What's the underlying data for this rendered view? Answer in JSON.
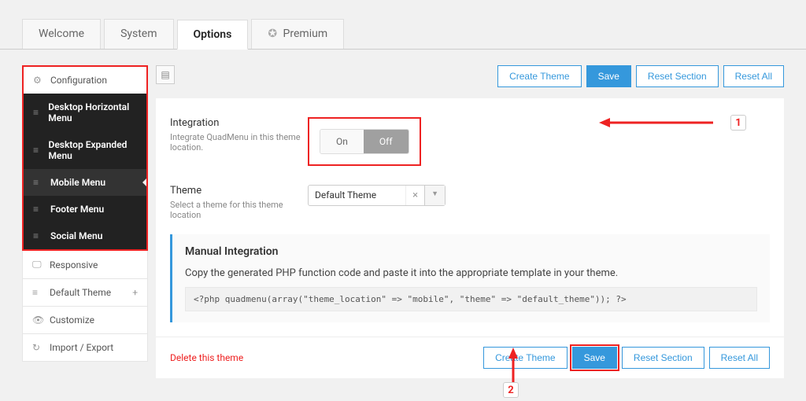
{
  "tabs": {
    "welcome": "Welcome",
    "system": "System",
    "options": "Options",
    "premium": "Premium"
  },
  "sidebar": {
    "configuration": "Configuration",
    "desktop_horizontal": "Desktop Horizontal Menu",
    "desktop_expanded": "Desktop Expanded Menu",
    "mobile_menu": "Mobile Menu",
    "footer_menu": "Footer Menu",
    "social_menu": "Social Menu",
    "responsive": "Responsive",
    "default_theme": "Default Theme",
    "customize": "Customize",
    "import_export": "Import / Export"
  },
  "toolbar": {
    "create_theme": "Create Theme",
    "save": "Save",
    "reset_section": "Reset Section",
    "reset_all": "Reset All"
  },
  "integration": {
    "title": "Integration",
    "desc": "Integrate QuadMenu in this theme location.",
    "on": "On",
    "off": "Off"
  },
  "theme_row": {
    "title": "Theme",
    "desc": "Select a theme for this theme location",
    "value": "Default Theme"
  },
  "manual": {
    "title": "Manual Integration",
    "text": "Copy the generated PHP function code and paste it into the appropriate template in your theme.",
    "code": "<?php quadmenu(array(\"theme_location\" => \"mobile\", \"theme\" => \"default_theme\")); ?>"
  },
  "footer": {
    "delete": "Delete this theme"
  },
  "callouts": {
    "one": "1",
    "two": "2"
  }
}
